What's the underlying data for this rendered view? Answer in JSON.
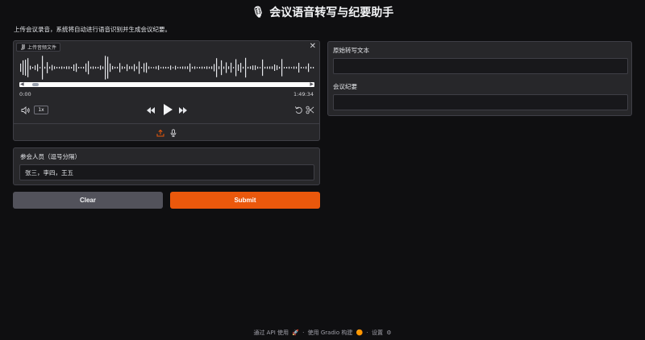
{
  "header": {
    "title": "会议语音转写与纪要助手",
    "description": "上传会议录音，系统将自动进行语音识别并生成会议纪要。"
  },
  "audio": {
    "label": "上传音频文件",
    "close_glyph": "✕",
    "time_start": "0:00",
    "time_end": "1:49:34",
    "speed_label": "1x",
    "progress_fraction": 0.02
  },
  "participants": {
    "label": "参会人员（逗号分隔）",
    "value": "张三，李四，王五"
  },
  "buttons": {
    "clear_label": "Clear",
    "submit_label": "Submit"
  },
  "outputs": {
    "transcript_label": "原始转写文本",
    "minutes_label": "会议纪要"
  },
  "footer": {
    "api_label": "通过 API 使用",
    "built_label": "使用 Gradio 构建",
    "settings_label": "设置",
    "separator": "·"
  },
  "colors": {
    "accent": "#ea580c",
    "background": "#0f0f11",
    "panel": "#27272a"
  }
}
